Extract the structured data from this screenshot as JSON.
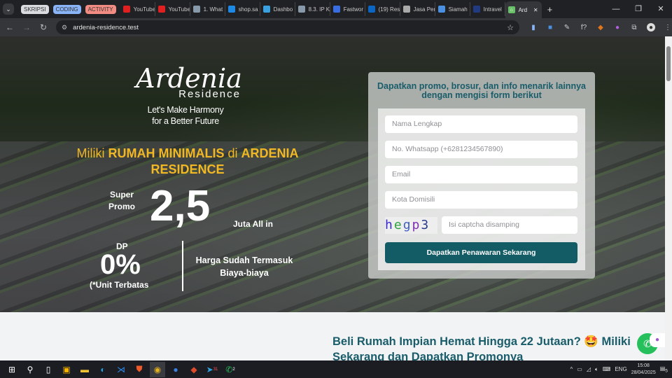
{
  "browser": {
    "tab_groups": [
      {
        "label": "SKRIPSI",
        "color": "#dadce0"
      },
      {
        "label": "CODING",
        "color": "#8ab4f8"
      },
      {
        "label": "ACTIVITY",
        "color": "#f28b82"
      }
    ],
    "tabs": [
      {
        "title": "YouTube",
        "icon": "youtube-icon",
        "color": "#e02020"
      },
      {
        "title": "YouTube",
        "icon": "youtube-icon",
        "color": "#e02020"
      },
      {
        "title": "1. What",
        "icon": "doc-icon",
        "color": "#8899aa"
      },
      {
        "title": "shop.sa",
        "icon": "s-icon",
        "color": "#1e88e5"
      },
      {
        "title": "Dashbo",
        "icon": "arrow-icon",
        "color": "#3aa0e0"
      },
      {
        "title": "8.3. IP K",
        "icon": "doc-icon",
        "color": "#8899aa"
      },
      {
        "title": "Fastwor",
        "icon": "network-icon",
        "color": "#3a6ee0"
      },
      {
        "title": "(19) Res",
        "icon": "linkedin-icon",
        "color": "#0a66c2"
      },
      {
        "title": "Jasa Per",
        "icon": "circle-icon",
        "color": "#aaaaaa"
      },
      {
        "title": "Siamah",
        "icon": "user-icon",
        "color": "#4a8fe0"
      },
      {
        "title": "Intravel",
        "icon": "shield-icon",
        "color": "#223a80"
      }
    ],
    "active_tab": {
      "title": "Ard",
      "icon": "house-icon",
      "color": "#6abf69"
    },
    "url": "ardenia-residence.test"
  },
  "hero": {
    "logo_script": "Ardenia",
    "logo_sub": "Residence",
    "tagline_1": "Let's Make Harmony",
    "tagline_2": "for a Better Future",
    "headline_1": "Miliki ",
    "headline_2": "RUMAH MINIMALIS",
    "headline_3": " di ",
    "headline_4": "ARDENIA RESIDENCE",
    "super": "Super",
    "promo": "Promo",
    "price": "2,5",
    "juta": "Juta All in",
    "dp": "DP",
    "dp_value": "0%",
    "unit": "(*Unit Terbatas",
    "harga_1": "Harga Sudah Termasuk",
    "harga_2": "Biaya-biaya"
  },
  "form": {
    "title": "Dapatkan promo, brosur, dan info menarik lainnya dengan mengisi form berikut",
    "fields": [
      "Nama Lengkap",
      "No. Whatsapp (+6281234567890)",
      "Email",
      "Kota Domisili"
    ],
    "captcha_text": "hegp3",
    "captcha_placeholder": "Isi captcha disamping",
    "submit": "Dapatkan Penawaran Sekarang"
  },
  "section2": {
    "heading": "Beli Rumah Impian Hemat Hingga 22 Jutaan? 🤩 Miliki Sekarang dan Dapatkan Promonya"
  },
  "taskbar": {
    "lang": "ENG",
    "time": "15:08",
    "date": "28/04/2025",
    "notif_count": "5",
    "whatsapp_badge": "2",
    "telegram_badge": "31"
  }
}
